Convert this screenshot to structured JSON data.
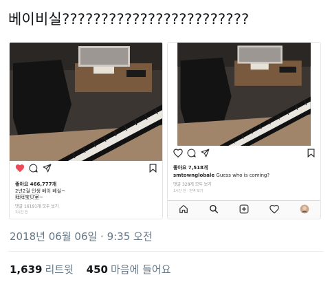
{
  "tweet": {
    "text": "베이비실????????????????????????",
    "timestamp": "2018년 06월 06일 · 9:35 오전",
    "retweet_count": "1,639",
    "retweet_label": "리트윗",
    "like_count": "450",
    "like_label": "마음에 들어요"
  },
  "left_post": {
    "likes": "좋아요 466,777개",
    "caption_line1": "2년2걸 인생 베이 베실~",
    "caption_line2": "拜拜宝贝室~",
    "comments": "댓글 16191개 모두 보기",
    "time": "3시간 전"
  },
  "right_post": {
    "likes": "좋아요 7,518개",
    "username": "smtownglobale",
    "caption": "Guess who is coming?",
    "comments": "댓글 328개 모두 보기",
    "time": "1시간 전 · 번역 보기"
  },
  "colors": {
    "like_red": "#ed4956",
    "twitter_gray": "#657786"
  }
}
